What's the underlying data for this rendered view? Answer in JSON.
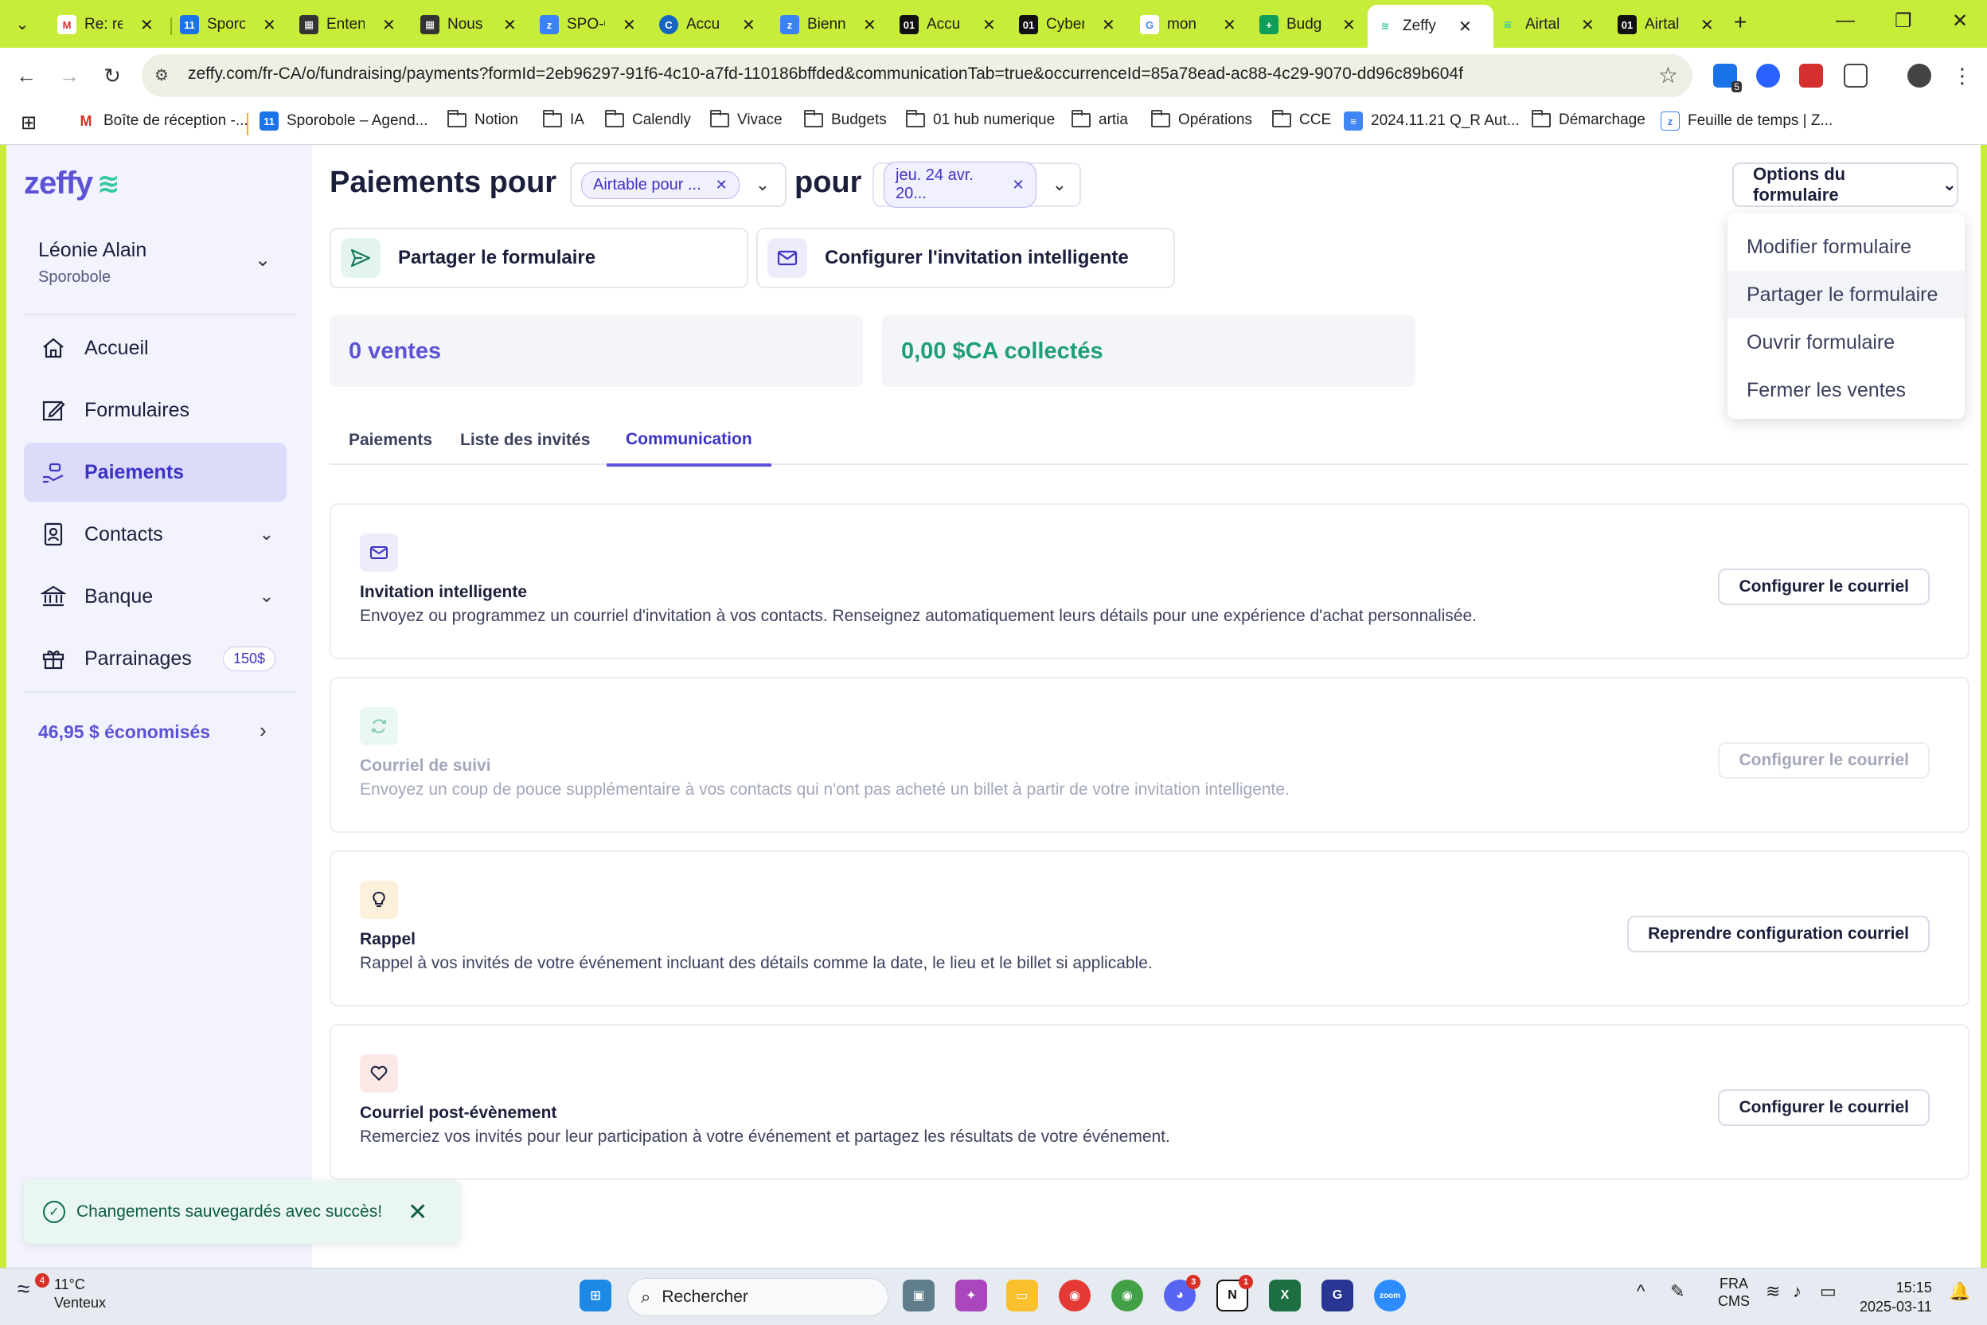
{
  "browser": {
    "tabs": [
      {
        "title": "Re: re",
        "icon": "gmail-icon",
        "color": "#d93025"
      },
      {
        "title": "Sporo",
        "icon": "calendar-icon",
        "color": "#1a73e8"
      },
      {
        "title": "Enten",
        "icon": "clapper-icon",
        "color": "#333333"
      },
      {
        "title": "Nous",
        "icon": "clapper-icon",
        "color": "#333333"
      },
      {
        "title": "SPO-0",
        "icon": "zeffy-icon",
        "color": "#3b82f6"
      },
      {
        "title": "Accu",
        "icon": "chrome-web-icon",
        "color": "#1565c0"
      },
      {
        "title": "Bienn",
        "icon": "zeffy-icon",
        "color": "#3b82f6"
      },
      {
        "title": "Accu",
        "icon": "01-icon",
        "color": "#111111"
      },
      {
        "title": "Cyber",
        "icon": "01-icon",
        "color": "#111111"
      },
      {
        "title": "mon",
        "icon": "google-icon",
        "color": "#4285f4"
      },
      {
        "title": "Budg",
        "icon": "sheets-icon",
        "color": "#0f9d58"
      },
      {
        "title": "Zeffy",
        "icon": "zeffy-icon",
        "color": "#35c9a2"
      },
      {
        "title": "Airtal",
        "icon": "zeffy-icon",
        "color": "#35c9a2"
      },
      {
        "title": "Airtal",
        "icon": "01-icon",
        "color": "#111111"
      }
    ],
    "url": "zeffy.com/fr-CA/o/fundraising/payments?formId=2eb96297-91f6-4c10-a7fd-110186bffded&communicationTab=true&occurrenceId=85a78ead-ac88-4c29-9070-dd96c89b604f",
    "extension_badge": "5",
    "bookmarks": [
      {
        "label": "Boîte de réception -...",
        "icon": "gmail-icon"
      },
      {
        "label": "Sporobole – Agend...",
        "icon": "calendar-icon"
      },
      {
        "label": "Notion",
        "icon": "folder-icon"
      },
      {
        "label": "IA",
        "icon": "folder-icon"
      },
      {
        "label": "Calendly",
        "icon": "folder-icon"
      },
      {
        "label": "Vivace",
        "icon": "folder-icon"
      },
      {
        "label": "Budgets",
        "icon": "folder-icon"
      },
      {
        "label": "01 hub numerique",
        "icon": "folder-icon"
      },
      {
        "label": "artia",
        "icon": "folder-icon"
      },
      {
        "label": "Opérations",
        "icon": "folder-icon"
      },
      {
        "label": "CCE",
        "icon": "folder-icon"
      },
      {
        "label": "2024.11.21 Q_R Aut...",
        "icon": "docs-icon"
      },
      {
        "label": "Démarchage",
        "icon": "folder-icon"
      },
      {
        "label": "Feuille de temps | Z...",
        "icon": "zeffy-icon"
      }
    ]
  },
  "app": {
    "logo": "zeffy",
    "user": {
      "name": "Léonie Alain",
      "org": "Sporobole"
    },
    "nav": [
      {
        "label": "Accueil",
        "icon": "home-icon",
        "active": false
      },
      {
        "label": "Formulaires",
        "icon": "edit-icon",
        "active": false
      },
      {
        "label": "Paiements",
        "icon": "payments-icon",
        "active": true
      },
      {
        "label": "Contacts",
        "icon": "contacts-icon",
        "active": false
      },
      {
        "label": "Banque",
        "icon": "bank-icon",
        "active": false
      },
      {
        "label": "Parrainages",
        "icon": "gift-icon",
        "active": false,
        "badge": "150$"
      }
    ],
    "savings": "46,95 $ économisés",
    "header": {
      "title": "Paiements pour",
      "form_chip": "Airtable pour ...",
      "pour": "pour",
      "date_chip": "jeu. 24 avr. 20...",
      "options_button": "Options du formulaire"
    },
    "options_menu": [
      "Modifier formulaire",
      "Partager le formulaire",
      "Ouvrir formulaire",
      "Fermer les ventes"
    ],
    "actions": {
      "share": "Partager le formulaire",
      "invite": "Configurer l'invitation intelligente"
    },
    "stats": {
      "sales": "0 ventes",
      "collected": "0,00 $CA collectés"
    },
    "tabs": [
      "Paiements",
      "Liste des invités",
      "Communication"
    ],
    "cards": [
      {
        "title": "Invitation intelligente",
        "desc": "Envoyez ou programmez un courriel d'invitation à vos contacts. Renseignez automatiquement leurs détails pour une expérience d'achat personnalisée.",
        "button": "Configurer le courriel",
        "icon": "mail-icon",
        "disabled": false
      },
      {
        "title": "Courriel de suivi",
        "desc": "Envoyez un coup de pouce supplémentaire à vos contacts qui n'ont pas acheté un billet à partir de votre invitation intelligente.",
        "button": "Configurer le courriel",
        "icon": "refresh-icon",
        "disabled": true
      },
      {
        "title": "Rappel",
        "desc": "Rappel à vos invités de votre événement incluant des détails comme la date, le lieu et le billet si applicable.",
        "button": "Reprendre configuration courriel",
        "icon": "lightbulb-icon",
        "disabled": false
      },
      {
        "title": "Courriel post-évènement",
        "desc": "Remerciez vos invités pour leur participation à votre événement et partagez les résultats de votre événement.",
        "button": "Configurer le courriel",
        "icon": "heart-icon",
        "disabled": false
      }
    ],
    "toast": "Changements sauvegardés avec succès!"
  },
  "taskbar": {
    "weather_temp": "11°C",
    "weather_desc": "Venteux",
    "weather_badge": "4",
    "search_placeholder": "Rechercher",
    "lang_top": "FRA",
    "lang_bottom": "CMS",
    "time": "15:15",
    "date": "2025-03-11",
    "discord_badge": "3",
    "notion_badge": "1"
  }
}
